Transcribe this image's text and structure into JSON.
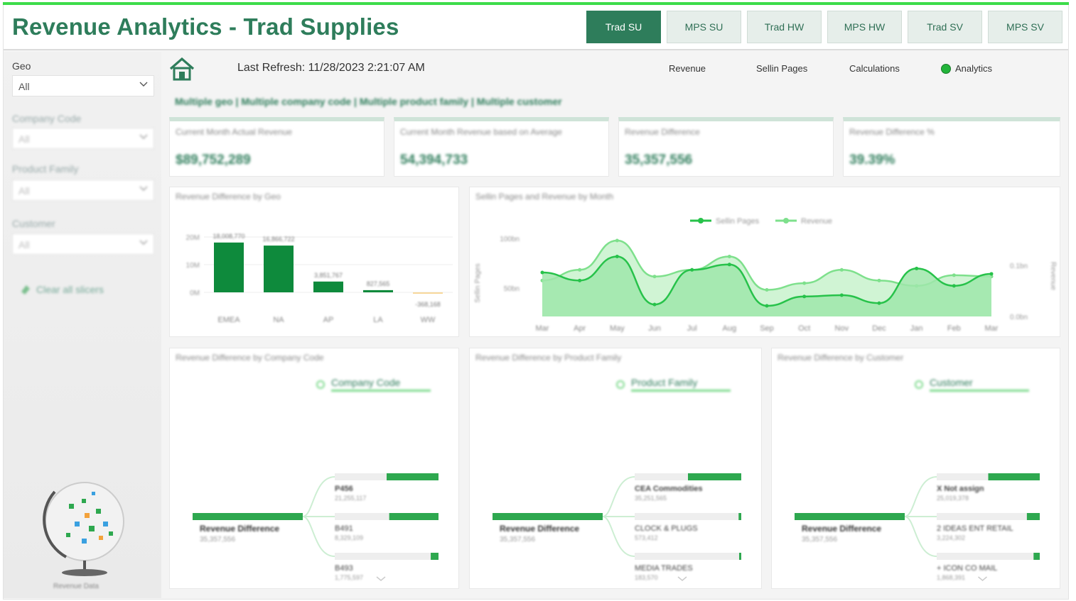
{
  "header": {
    "title": "Revenue Analytics - Trad Supplies",
    "tabs": [
      {
        "label": "Trad SU",
        "active": true
      },
      {
        "label": "MPS SU",
        "active": false
      },
      {
        "label": "Trad HW",
        "active": false
      },
      {
        "label": "MPS HW",
        "active": false
      },
      {
        "label": "Trad SV",
        "active": false
      },
      {
        "label": "MPS SV",
        "active": false
      }
    ]
  },
  "sidebar": {
    "geo_label": "Geo",
    "geo_value": "All",
    "company_code_label": "Company Code",
    "company_code_value": "All",
    "product_family_label": "Product Family",
    "product_family_value": "All",
    "customer_label": "Customer",
    "customer_value": "All",
    "clear_label": "Clear all slicers",
    "globe_caption": "Revenue Data"
  },
  "main": {
    "last_refresh": "Last Refresh: 11/28/2023 2:21:07 AM",
    "subnav": {
      "revenue": "Revenue",
      "sellin": "Sellin Pages",
      "calculations": "Calculations",
      "analytics": "Analytics"
    },
    "filter_summary": "Multiple geo | Multiple company code | Multiple product family | Multiple customer"
  },
  "kpis": [
    {
      "label": "Current Month Actual Revenue",
      "value": "$89,752,289"
    },
    {
      "label": "Current Month Revenue based on Average",
      "value": "54,394,733"
    },
    {
      "label": "Revenue Difference",
      "value": "35,357,556"
    },
    {
      "label": "Revenue Difference %",
      "value": "39.39%"
    }
  ],
  "colors": {
    "brand": "#2e7d5b",
    "bar": "#0e8a3c",
    "negative": "#f7d79a",
    "line_dark": "#27c24a",
    "line_light": "#7ee08c",
    "active_tab": "#2e7d5b"
  },
  "chart_data": [
    {
      "type": "bar",
      "title": "Revenue Difference by Geo",
      "categories": [
        "EMEA",
        "NA",
        "AP",
        "LA",
        "WW"
      ],
      "values": [
        18.0,
        16.9,
        3.9,
        0.8,
        -0.4
      ],
      "data_labels": [
        "18,008,770",
        "16,866,722",
        "3,851,767",
        "827,565",
        "-368,168"
      ],
      "y_ticks": [
        "20M",
        "10M",
        "0M"
      ]
    },
    {
      "type": "area",
      "title": "Sellin Pages and Revenue by Month",
      "x": [
        "Mar",
        "Apr",
        "May",
        "Jun",
        "Jul",
        "Aug",
        "Sep",
        "Oct",
        "Nov",
        "Dec",
        "Jan",
        "Feb",
        "Mar"
      ],
      "series": [
        {
          "name": "Sellin Pages",
          "values": [
            128,
            122,
            140,
            104,
            130,
            134,
            103,
            110,
            111,
            105,
            131,
            118,
            127
          ]
        },
        {
          "name": "Revenue",
          "values": [
            122,
            130,
            152,
            125,
            130,
            140,
            115,
            120,
            130,
            122,
            118,
            126,
            125
          ]
        }
      ],
      "y_left_label": "Sellin Pages",
      "y_left_ticks": [
        "100bn",
        "50bn"
      ],
      "y_right_label": "Revenue",
      "y_right_ticks": [
        "0.1bn",
        "0.0bn"
      ],
      "legend": "top-center"
    }
  ],
  "trees": [
    {
      "title": "Revenue Difference by Company Code",
      "dropdown": "Company Code",
      "root_label": "Revenue Difference",
      "root_value": "35,357,556",
      "nodes": [
        {
          "label": "P456",
          "value": "21,255,117",
          "fill": 1.0
        },
        {
          "label": "B491",
          "value": "8,329,109",
          "fill": 0.95
        },
        {
          "label": "B493",
          "value": "1,775,597",
          "fill": 0.15
        }
      ]
    },
    {
      "title": "Revenue Difference by Product Family",
      "dropdown": "Product Family",
      "root_label": "Revenue Difference",
      "root_value": "35,357,556",
      "nodes": [
        {
          "label": "CEA Commodities",
          "value": "35,251,565",
          "fill": 1.0
        },
        {
          "label": "CLOCK & PLUGS",
          "value": "573,412",
          "fill": 0.05
        },
        {
          "label": "MEDIA TRADES",
          "value": "183,570",
          "fill": 0.02
        }
      ]
    },
    {
      "title": "Revenue Difference by Customer",
      "dropdown": "Customer",
      "root_label": "Revenue Difference",
      "root_value": "35,357,556",
      "nodes": [
        {
          "label": "X Not assign",
          "value": "25,019,378",
          "fill": 1.0
        },
        {
          "label": "2 IDEAS ENT RETAIL",
          "value": "3,224,302",
          "fill": 0.25
        },
        {
          "label": "+ ICON CO MAIL",
          "value": "1,868,391",
          "fill": 0.12
        }
      ]
    }
  ]
}
